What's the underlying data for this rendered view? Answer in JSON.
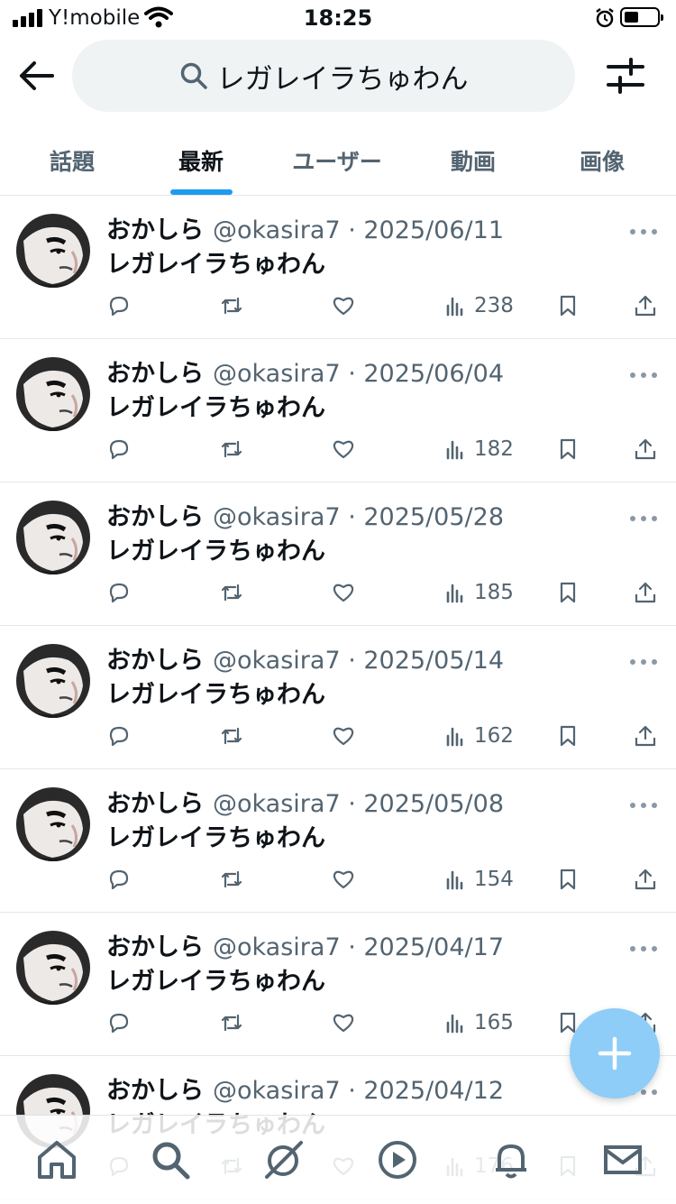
{
  "status": {
    "carrier": "Y!mobile",
    "time": "18:25",
    "battery_level": 0.45
  },
  "search": {
    "query": "レガレイラちゅわん"
  },
  "tabs": [
    {
      "label": "話題",
      "active": false
    },
    {
      "label": "最新",
      "active": true
    },
    {
      "label": "ユーザー",
      "active": false
    },
    {
      "label": "動画",
      "active": false
    },
    {
      "label": "画像",
      "active": false
    }
  ],
  "tweets": [
    {
      "name": "おかしら",
      "handle": "@okasira7",
      "date": "2025/06/11",
      "text": "レガレイラちゅわん",
      "views": "238"
    },
    {
      "name": "おかしら",
      "handle": "@okasira7",
      "date": "2025/06/04",
      "text": "レガレイラちゅわん",
      "views": "182"
    },
    {
      "name": "おかしら",
      "handle": "@okasira7",
      "date": "2025/05/28",
      "text": "レガレイラちゅわん",
      "views": "185"
    },
    {
      "name": "おかしら",
      "handle": "@okasira7",
      "date": "2025/05/14",
      "text": "レガレイラちゅわん",
      "views": "162"
    },
    {
      "name": "おかしら",
      "handle": "@okasira7",
      "date": "2025/05/08",
      "text": "レガレイラちゅわん",
      "views": "154"
    },
    {
      "name": "おかしら",
      "handle": "@okasira7",
      "date": "2025/04/17",
      "text": "レガレイラちゅわん",
      "views": "165"
    },
    {
      "name": "おかしら",
      "handle": "@okasira7",
      "date": "2025/04/12",
      "text": "レガレイラちゅわん",
      "views": "176"
    }
  ],
  "nav": [
    "home-icon",
    "search-icon",
    "grok-icon",
    "play-icon",
    "bell-icon",
    "mail-icon"
  ],
  "colors": {
    "accent": "#1d9bf0",
    "fab": "#8dcdf8",
    "text": "#0f1419",
    "muted": "#536471"
  }
}
